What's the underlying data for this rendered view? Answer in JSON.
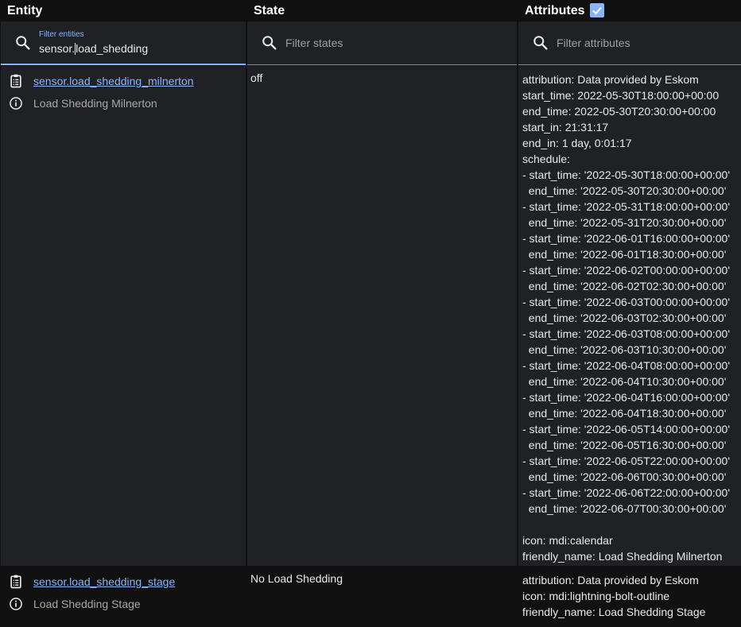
{
  "headers": {
    "entity": "Entity",
    "state": "State",
    "attributes": "Attributes",
    "attributes_checkbox_checked": true
  },
  "filters": {
    "entity": {
      "label": "Filter entities",
      "value_before_cursor": "sensor.",
      "value_after_cursor": "load_shedding"
    },
    "state": {
      "placeholder": "Filter states"
    },
    "attributes": {
      "placeholder": "Filter attributes"
    }
  },
  "rows": [
    {
      "entity_id": "sensor.load_shedding_milnerton",
      "friendly_name": "Load Shedding Milnerton",
      "state": "off",
      "attributes": "attribution: Data provided by Eskom\nstart_time: 2022-05-30T18:00:00+00:00\nend_time: 2022-05-30T20:30:00+00:00\nstart_in: 21:31:17\nend_in: 1 day, 0:01:17\nschedule:\n- start_time: '2022-05-30T18:00:00+00:00'\n  end_time: '2022-05-30T20:30:00+00:00'\n- start_time: '2022-05-31T18:00:00+00:00'\n  end_time: '2022-05-31T20:30:00+00:00'\n- start_time: '2022-06-01T16:00:00+00:00'\n  end_time: '2022-06-01T18:30:00+00:00'\n- start_time: '2022-06-02T00:00:00+00:00'\n  end_time: '2022-06-02T02:30:00+00:00'\n- start_time: '2022-06-03T00:00:00+00:00'\n  end_time: '2022-06-03T02:30:00+00:00'\n- start_time: '2022-06-03T08:00:00+00:00'\n  end_time: '2022-06-03T10:30:00+00:00'\n- start_time: '2022-06-04T08:00:00+00:00'\n  end_time: '2022-06-04T10:30:00+00:00'\n- start_time: '2022-06-04T16:00:00+00:00'\n  end_time: '2022-06-04T18:30:00+00:00'\n- start_time: '2022-06-05T14:00:00+00:00'\n  end_time: '2022-06-05T16:30:00+00:00'\n- start_time: '2022-06-05T22:00:00+00:00'\n  end_time: '2022-06-06T00:30:00+00:00'\n- start_time: '2022-06-06T22:00:00+00:00'\n  end_time: '2022-06-07T00:30:00+00:00'\n\nicon: mdi:calendar\nfriendly_name: Load Shedding Milnerton"
    },
    {
      "entity_id": "sensor.load_shedding_stage",
      "friendly_name": "Load Shedding Stage",
      "state": "No Load Shedding",
      "attributes": "attribution: Data provided by Eskom\nicon: mdi:lightning-bolt-outline\nfriendly_name: Load Shedding Stage"
    }
  ],
  "icons": {
    "search": "search-icon",
    "more_info": "clipboard-list-icon",
    "info": "info-circle-icon",
    "checkbox": "checkbox-checked-icon"
  },
  "colors": {
    "accent": "#8ab4f8",
    "background": "#111111",
    "surface": "#202124",
    "text": "#e8eaed",
    "secondary_text": "#a8a8a8"
  }
}
